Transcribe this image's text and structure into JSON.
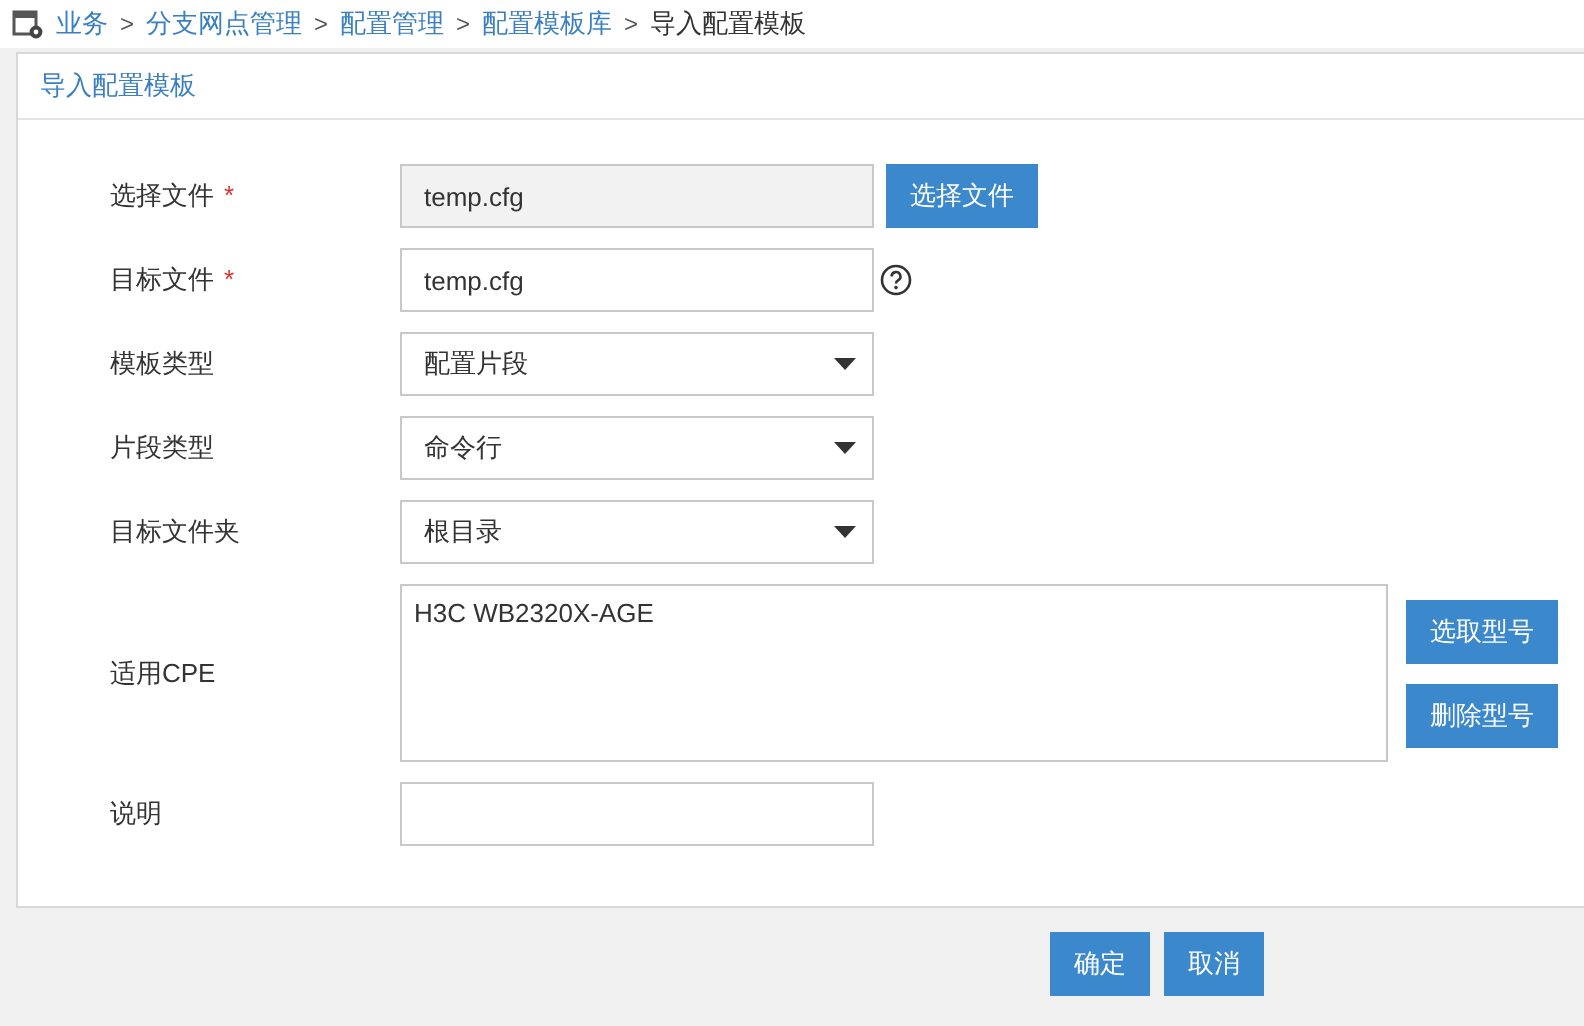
{
  "breadcrumb": [
    {
      "label": "业务",
      "link": true
    },
    {
      "label": "分支网点管理",
      "link": true
    },
    {
      "label": "配置管理",
      "link": true
    },
    {
      "label": "配置模板库",
      "link": true
    },
    {
      "label": "导入配置模板",
      "link": false
    }
  ],
  "breadcrumb_separator": ">",
  "panel_title": "导入配置模板",
  "fields": [
    {
      "kind": "readonly",
      "label": "选择文件",
      "required_mark": "*",
      "value": "temp.cfg",
      "button": "选择文件"
    },
    {
      "kind": "text",
      "label": "目标文件",
      "required_mark": "*",
      "value": "temp.cfg",
      "help": true
    },
    {
      "kind": "select",
      "label": "模板类型",
      "value": "配置片段"
    },
    {
      "kind": "select",
      "label": "片段类型",
      "value": "命令行"
    },
    {
      "kind": "select",
      "label": "目标文件夹",
      "value": "根目录"
    },
    {
      "kind": "list",
      "label": "适用CPE",
      "items": [
        "H3C WB2320X-AGE"
      ],
      "buttons": [
        "选取型号",
        "删除型号"
      ]
    },
    {
      "kind": "text",
      "label": "说明"
    }
  ],
  "footer_buttons": [
    "确定",
    "取消"
  ]
}
